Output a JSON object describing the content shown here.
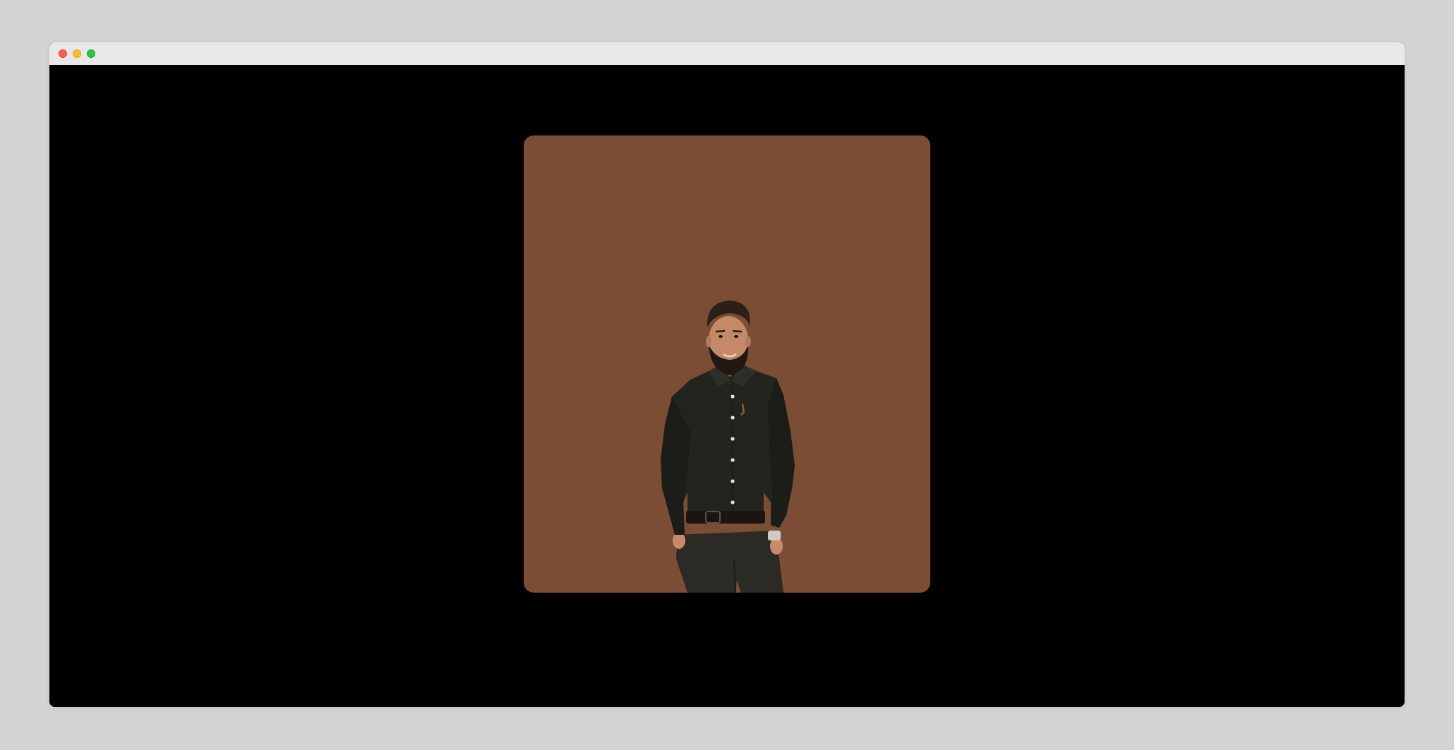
{
  "window": {
    "controls": [
      "close",
      "minimize",
      "zoom"
    ]
  },
  "viewer": {
    "background_color": "#000000"
  },
  "photo": {
    "backdrop_color": "#7b4d35",
    "subject": "man-in-black-shirt-portrait",
    "shirt_color": "#24241f",
    "pants_color": "#2b2a24"
  }
}
